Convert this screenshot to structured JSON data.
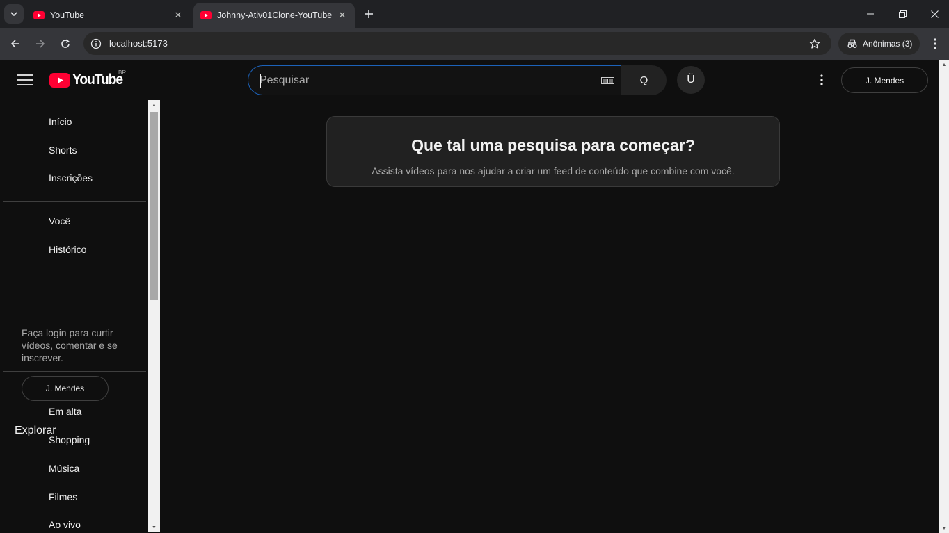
{
  "browser": {
    "tabs": [
      {
        "title": "YouTube",
        "active": false
      },
      {
        "title": "Johnny-Ativ01Clone-YouTube",
        "active": true
      }
    ],
    "url": "localhost:5173",
    "incognito_label": "Anônimas (3)"
  },
  "masthead": {
    "logo_text": "YouTube",
    "region": "BR",
    "search_placeholder": "Pesquisar",
    "search_button": "Q",
    "voice_button": "Ü",
    "signin_label": "J. Mendes"
  },
  "sidebar": {
    "primary": [
      "Início",
      "Shorts",
      "Inscrições"
    ],
    "you": [
      "Você",
      "Histórico"
    ],
    "login_prompt": "Faça login para curtir vídeos, comentar e se inscrever.",
    "signin_label": "J. Mendes",
    "explore_heading": "Explorar",
    "explore": [
      "Em alta",
      "Shopping",
      "Música",
      "Filmes",
      "Ao vivo"
    ]
  },
  "main": {
    "empty_title": "Que tal uma pesquisa para começar?",
    "empty_subtitle": "Assista vídeos para nos ajudar a criar um feed de conteúdo que combine com você."
  },
  "colors": {
    "background": "#0f0f0f",
    "brand_red": "#ff0033",
    "focus_blue": "#1c62b9"
  }
}
